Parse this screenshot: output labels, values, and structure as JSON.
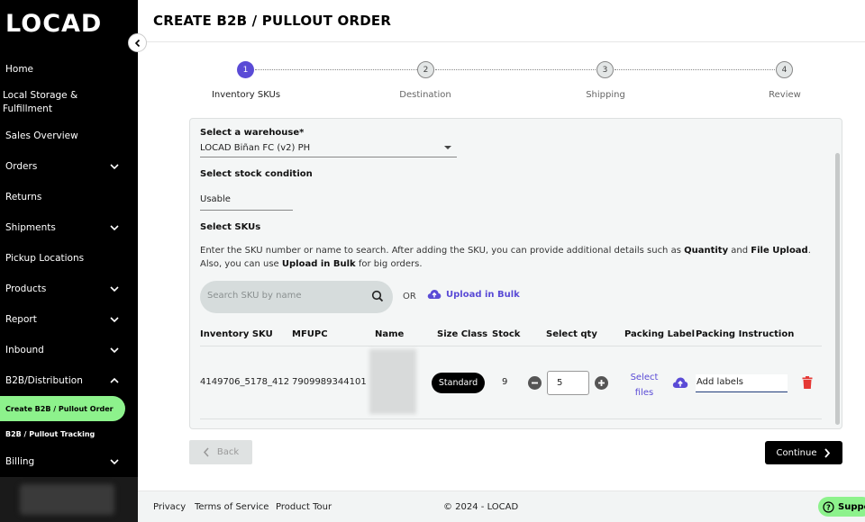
{
  "brand": {
    "logo_text": "LOCAD",
    "accent": "#5a4bd6",
    "active_nav": "#8df28c"
  },
  "sidebar": {
    "items": [
      {
        "label": "Home",
        "chevron": false
      },
      {
        "label": "Local Storage & Fulfillment",
        "chevron": false
      },
      {
        "label": "Sales Overview",
        "chevron": false
      },
      {
        "label": "Orders",
        "chevron": true
      },
      {
        "label": "Returns",
        "chevron": false
      },
      {
        "label": "Shipments",
        "chevron": true
      },
      {
        "label": "Pickup Locations",
        "chevron": false
      },
      {
        "label": "Products",
        "chevron": true
      },
      {
        "label": "Report",
        "chevron": true
      },
      {
        "label": "Inbound",
        "chevron": true
      },
      {
        "label": "B2B/Distribution",
        "chevron": true,
        "expanded": true
      }
    ],
    "sub_items": [
      {
        "label": "Create B2B / Pullout Order",
        "active": true
      },
      {
        "label": "B2B / Pullout Tracking",
        "active": false
      }
    ],
    "billing": {
      "label": "Billing"
    }
  },
  "page": {
    "title": "CREATE B2B / PULLOUT ORDER"
  },
  "stepper": {
    "steps": [
      {
        "num": "1",
        "label": "Inventory SKUs",
        "active": true
      },
      {
        "num": "2",
        "label": "Destination",
        "active": false
      },
      {
        "num": "3",
        "label": "Shipping",
        "active": false
      },
      {
        "num": "4",
        "label": "Review",
        "active": false
      }
    ]
  },
  "form": {
    "warehouse_label": "Select a warehouse*",
    "warehouse_value": "LOCAD Biñan FC (v2) PH",
    "condition_label": "Select stock condition",
    "condition_value": "Usable",
    "skus_label": "Select SKUs",
    "desc_1": "Enter the SKU number or name to search. After adding the SKU, you can provide additional details such as ",
    "desc_quantity": "Quantity",
    "desc_2": " and ",
    "desc_file": "File Upload",
    "desc_3": ". Also, you can use ",
    "desc_bulk": "Upload in Bulk",
    "desc_4": " for big orders.",
    "search_placeholder": "Search SKU by name",
    "or_text": "OR",
    "upload_bulk": "Upload in Bulk"
  },
  "table": {
    "headers": [
      "Inventory SKU",
      "MFUPC",
      "Name",
      "Size Class",
      "Stock",
      "Select qty",
      "Packing Label",
      "Packing Instruction"
    ],
    "rows": [
      {
        "sku": "4149706_5178_412",
        "mfupc": "7909989344101",
        "size_class": "Standard",
        "stock": "9",
        "qty": "5",
        "select_files": "Select files",
        "instruction": "Add labels"
      }
    ]
  },
  "buttons": {
    "back": "Back",
    "continue": "Continue"
  },
  "footer": {
    "privacy": "Privacy",
    "terms": "Terms of Service",
    "tour": "Product Tour",
    "copyright": "© 2024 - LOCAD",
    "support": "Suppo"
  }
}
